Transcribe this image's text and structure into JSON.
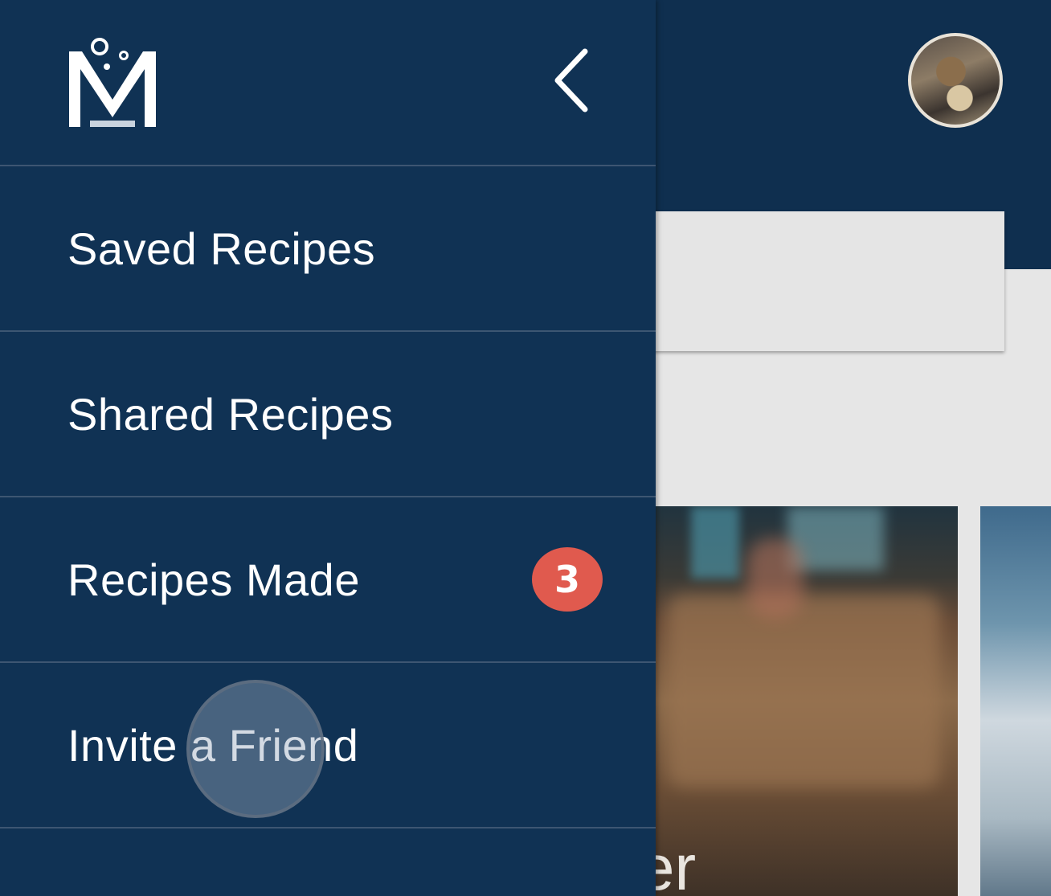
{
  "drawer": {
    "logo_icon": "brand-m-logo-icon",
    "collapse_icon": "chevron-left-icon",
    "items": [
      {
        "label": "Saved Recipes"
      },
      {
        "label": "Shared Recipes"
      },
      {
        "label": "Recipes Made",
        "badge": "3"
      },
      {
        "label": "Invite a Friend"
      }
    ]
  },
  "background": {
    "avatar_icon": "user-avatar",
    "card_title_fragment": "er"
  },
  "colors": {
    "drawer_bg": "#103254",
    "divider": "#3d5672",
    "badge": "#e05a4e",
    "text": "#ffffff"
  }
}
